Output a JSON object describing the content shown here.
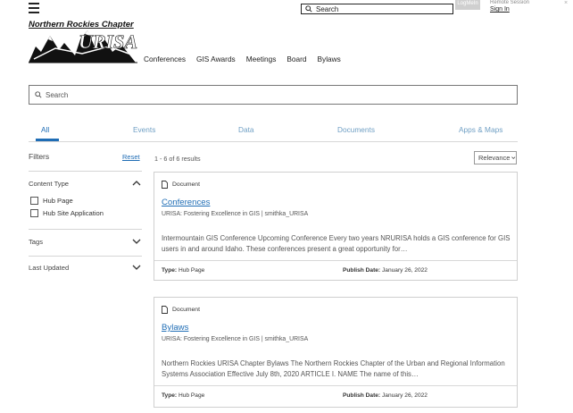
{
  "topbar": {
    "menu_icon": "hamburger-icon",
    "search_placeholder": "Search",
    "remote_tag": "LogMeIn",
    "remote_label": "Remote Session",
    "sign_in": "Sign In"
  },
  "logo": {
    "title": "Northern Rockies Chapter",
    "wordmark": "URISA"
  },
  "nav": [
    "Conferences",
    "GIS Awards",
    "Meetings",
    "Board",
    "Bylaws"
  ],
  "search": {
    "placeholder": "Search"
  },
  "tabs": [
    "All",
    "Events",
    "Data",
    "Documents",
    "Apps & Maps"
  ],
  "filters": {
    "title": "Filters",
    "reset": "Reset",
    "content_type": {
      "label": "Content Type",
      "options": [
        "Hub Page",
        "Hub Site Application"
      ]
    },
    "tags": {
      "label": "Tags"
    },
    "last_updated": {
      "label": "Last Updated"
    }
  },
  "results": {
    "count_text": "1 - 6 of 6 results",
    "sort_label": "Relevance",
    "type_prefix": "Type:",
    "date_prefix": "Publish Date:",
    "items": [
      {
        "type": "Document",
        "title": "Conferences",
        "meta": "URISA: Fostering Excellence in GIS | smithka_URISA",
        "desc": "Intermountain GIS Conference Upcoming Conference Every two years NRURISA holds a GIS conference for GIS users in and around Idaho. These conferences present a great opportunity for…",
        "item_type": "Hub Page",
        "publish_date": "January 26, 2022"
      },
      {
        "type": "Document",
        "title": "Bylaws",
        "meta": "URISA: Fostering Excellence in GIS | smithka_URISA",
        "desc": "Northern Rockies URISA Chapter Bylaws The Northern Rockies Chapter of the Urban and Regional Information Systems Association Effective July 8th, 2020 ARTICLE I. NAME The name of this…",
        "item_type": "Hub Page",
        "publish_date": "January 26, 2022"
      }
    ]
  }
}
